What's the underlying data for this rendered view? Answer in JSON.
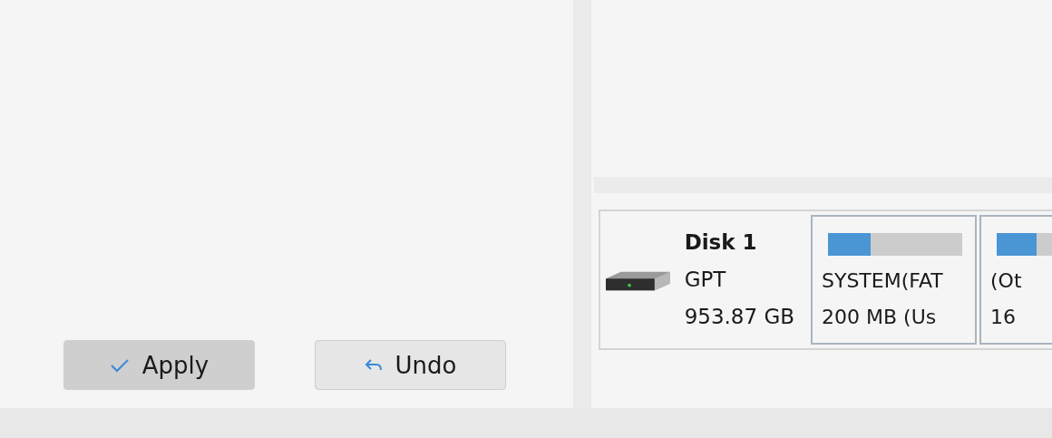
{
  "actions": [
    {
      "kind": "apply",
      "label": "Apply",
      "hovered": true
    },
    {
      "kind": "undo",
      "label": "Undo",
      "hovered": false
    }
  ],
  "disk": {
    "name": "Disk 1",
    "style": "GPT",
    "size": "953.87 GB",
    "partitions": [
      {
        "name": "SYSTEM(FAT",
        "size": "200 MB (Us",
        "level": 0.32
      },
      {
        "name": "(Ot",
        "size": "16",
        "level": 0.3
      }
    ]
  }
}
